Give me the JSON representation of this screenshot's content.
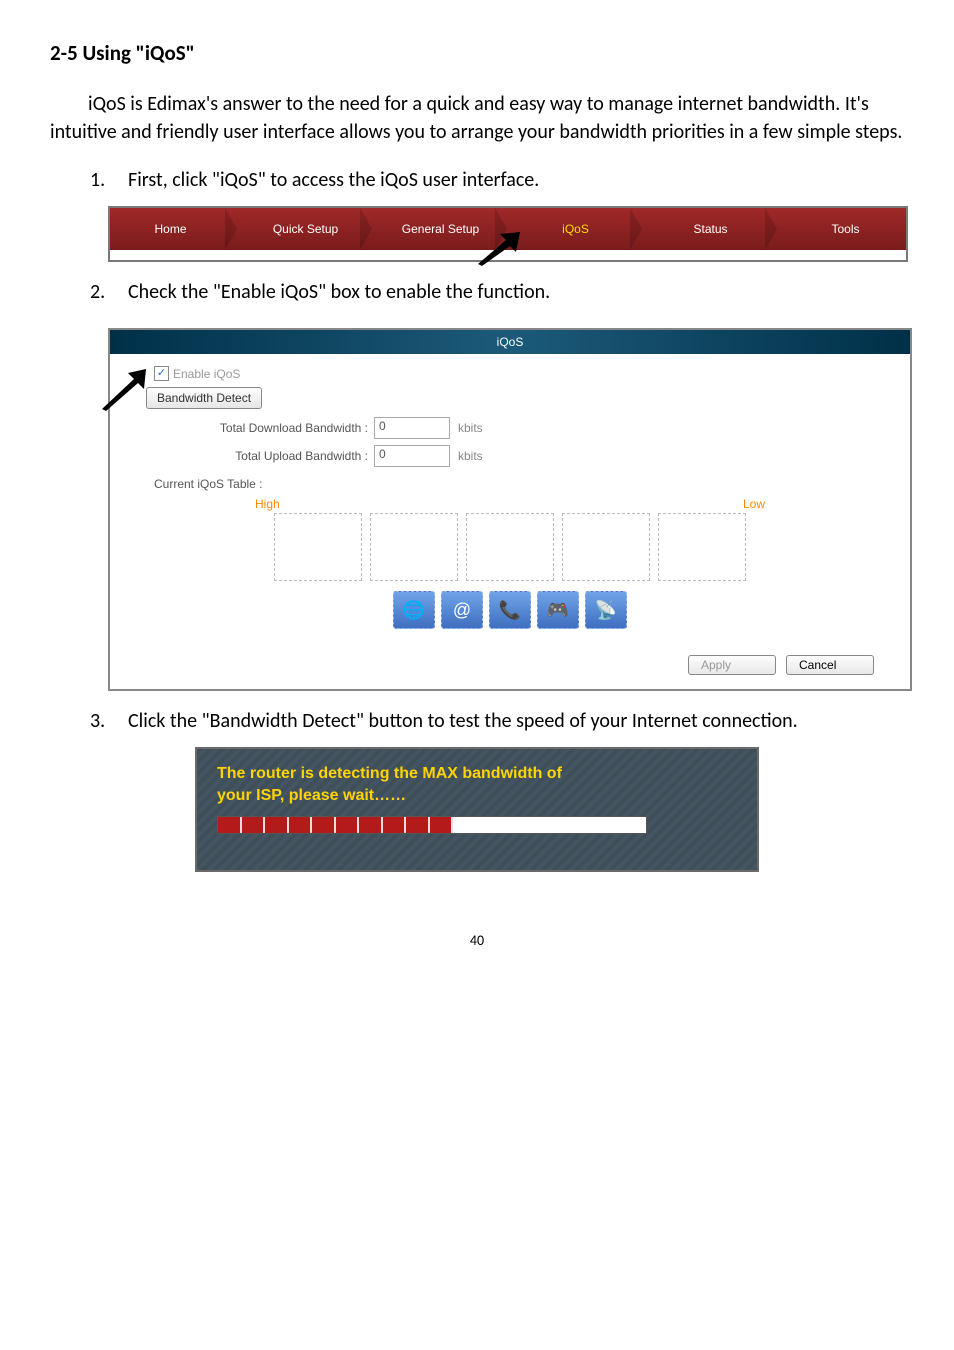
{
  "heading": "2-5 Using \"iQoS\"",
  "intro": "iQoS is Edimax's answer to the need for a quick and easy way to manage internet bandwidth. It's intuitive and friendly user interface allows you to arrange your bandwidth priorities in a few simple steps.",
  "steps": {
    "s1_num": "1.",
    "s1_text": "First, click \"iQoS\" to access the iQoS user interface.",
    "s2_num": "2.",
    "s2_text": "Check the \"Enable iQoS\" box to enable the function.",
    "s3_num": "3.",
    "s3_text": "Click the \"Bandwidth Detect\" button to test the speed of your Internet connection."
  },
  "nav": {
    "home": "Home",
    "quick": "Quick Setup",
    "general": "General Setup",
    "iqos": "iQoS",
    "status": "Status",
    "tools": "Tools"
  },
  "panel": {
    "title": "iQoS",
    "enable_label": "Enable iQoS",
    "bw_detect": "Bandwidth Detect",
    "dl_label": "Total Download Bandwidth :",
    "dl_value": "0",
    "ul_label": "Total Upload Bandwidth :",
    "ul_value": "0",
    "unit": "kbits",
    "current_table": "Current iQoS Table :",
    "high": "High",
    "low": "Low",
    "apply": "Apply",
    "cancel": "Cancel",
    "icons": [
      "🌐",
      "@",
      "📞",
      "🎮",
      "📡"
    ]
  },
  "detect": {
    "line1": "The router is detecting the MAX bandwidth of",
    "line2": "your ISP, please wait……"
  },
  "page_number": "40"
}
